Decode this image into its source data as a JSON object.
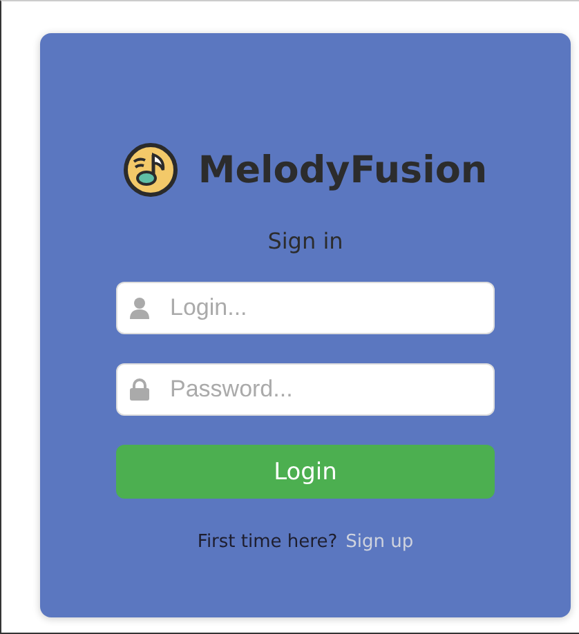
{
  "brand": {
    "name": "MelodyFusion"
  },
  "heading": "Sign in",
  "fields": [
    {
      "kind": "user",
      "placeholder": "Login..."
    },
    {
      "kind": "lock",
      "placeholder": "Password..."
    }
  ],
  "submit": "Login",
  "footer": {
    "prompt": "First time here?",
    "link": "Sign up"
  }
}
